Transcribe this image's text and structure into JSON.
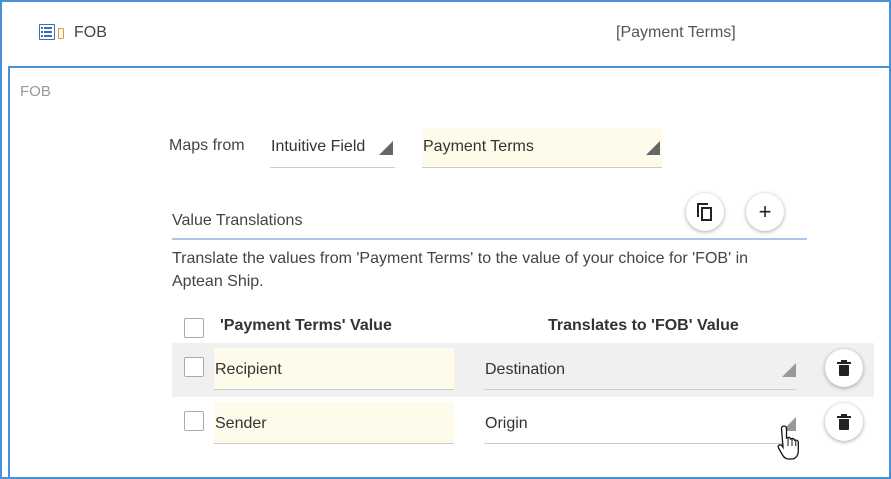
{
  "header": {
    "field_name": "FOB",
    "mapping_label": "[Payment Terms]",
    "icons": [
      "list-icon",
      "tag-icon"
    ]
  },
  "section": {
    "title": "FOB"
  },
  "maps_from": {
    "label": "Maps from",
    "source_value": "Intuitive Field",
    "field_value": "Payment Terms"
  },
  "value_translations": {
    "label": "Value Translations",
    "copy_icon": "copy-icon",
    "add_icon": "plus-icon",
    "description": "Translate the values from 'Payment Terms' to the value of your choice for 'FOB' in Aptean Ship."
  },
  "table": {
    "columns": [
      "'Payment Terms' Value",
      "Translates to 'FOB' Value"
    ],
    "rows": [
      {
        "value": "Recipient",
        "translation": "Destination"
      },
      {
        "value": "Sender",
        "translation": "Origin"
      }
    ]
  },
  "colors": {
    "accent": "#4a90d9",
    "input_bg": "#fffbea",
    "row_highlight": "#f0f0f0"
  }
}
